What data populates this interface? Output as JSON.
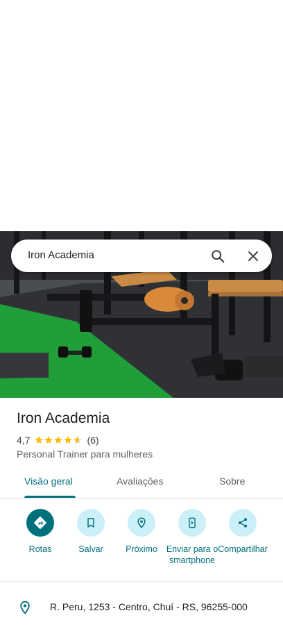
{
  "search": {
    "query": "Iron Academia"
  },
  "place": {
    "name": "Iron Academia",
    "rating": "4,7",
    "rating_value": 4.7,
    "reviews_count": "(6)",
    "category": "Personal Trainer para mulheres"
  },
  "tabs": [
    {
      "label": "Visão geral",
      "active": true
    },
    {
      "label": "Avaliações",
      "active": false
    },
    {
      "label": "Sobre",
      "active": false
    }
  ],
  "actions": [
    {
      "label": "Rotas",
      "icon": "directions-icon"
    },
    {
      "label": "Salvar",
      "icon": "bookmark-icon"
    },
    {
      "label": "Próximo",
      "icon": "nearby-icon"
    },
    {
      "label": "Enviar para o smartphone",
      "icon": "send-to-phone-icon"
    },
    {
      "label": "Compartilhar",
      "icon": "share-icon"
    }
  ],
  "address": {
    "text": "R. Peru, 1253 - Centro, Chuí - RS, 96255-000",
    "icon": "location-pin-icon"
  },
  "colors": {
    "accent": "#00707b",
    "accent_light": "#cbf0f8",
    "star": "#fbbc04"
  }
}
